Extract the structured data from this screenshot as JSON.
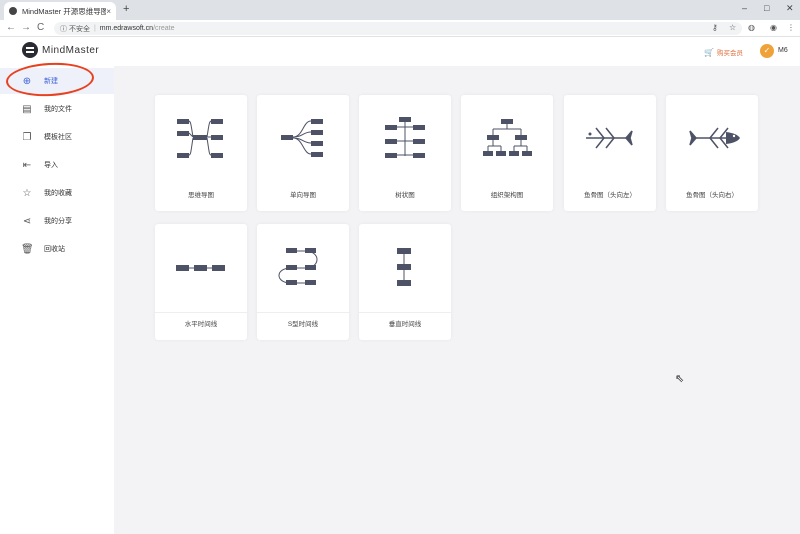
{
  "browser": {
    "tab_title": "MindMaster 开源思维导图",
    "tab_close": "×",
    "new_tab": "+",
    "win_min": "–",
    "win_max": "□",
    "win_close": "✕",
    "back": "←",
    "forward": "→",
    "reload": "C",
    "security": "不安全",
    "url_host": "mm.edrawsoft.cn",
    "url_path": "/create"
  },
  "app": {
    "logo_text": "MindMaster",
    "vip_label": "购买会员",
    "username": "M6"
  },
  "sidebar": {
    "items": [
      {
        "label": "新建",
        "icon": "new-file-icon",
        "glyph": "⊕"
      },
      {
        "label": "我的文件",
        "icon": "file-icon",
        "glyph": "▤"
      },
      {
        "label": "模板社区",
        "icon": "template-icon",
        "glyph": "❐"
      },
      {
        "label": "导入",
        "icon": "import-icon",
        "glyph": "⇤"
      },
      {
        "label": "我的收藏",
        "icon": "star-icon",
        "glyph": "☆"
      },
      {
        "label": "我的分享",
        "icon": "share-icon",
        "glyph": "⋖"
      },
      {
        "label": "回收站",
        "icon": "trash-icon",
        "glyph": "🗑"
      }
    ]
  },
  "templates": [
    {
      "label": "思维导图",
      "type": "mindmap"
    },
    {
      "label": "单向导图",
      "type": "right-map"
    },
    {
      "label": "树状图",
      "type": "tree"
    },
    {
      "label": "组织架构图",
      "type": "org"
    },
    {
      "label": "鱼骨图（头向左）",
      "type": "fish-left"
    },
    {
      "label": "鱼骨图（头向右）",
      "type": "fish-right"
    },
    {
      "label": "水平时间线",
      "type": "timeline-h"
    },
    {
      "label": "S型时间线",
      "type": "timeline-s"
    },
    {
      "label": "垂直时间线",
      "type": "timeline-v"
    }
  ],
  "colors": {
    "accent": "#3e63d6",
    "node": "#4d5266",
    "annotation": "#e8411f"
  }
}
